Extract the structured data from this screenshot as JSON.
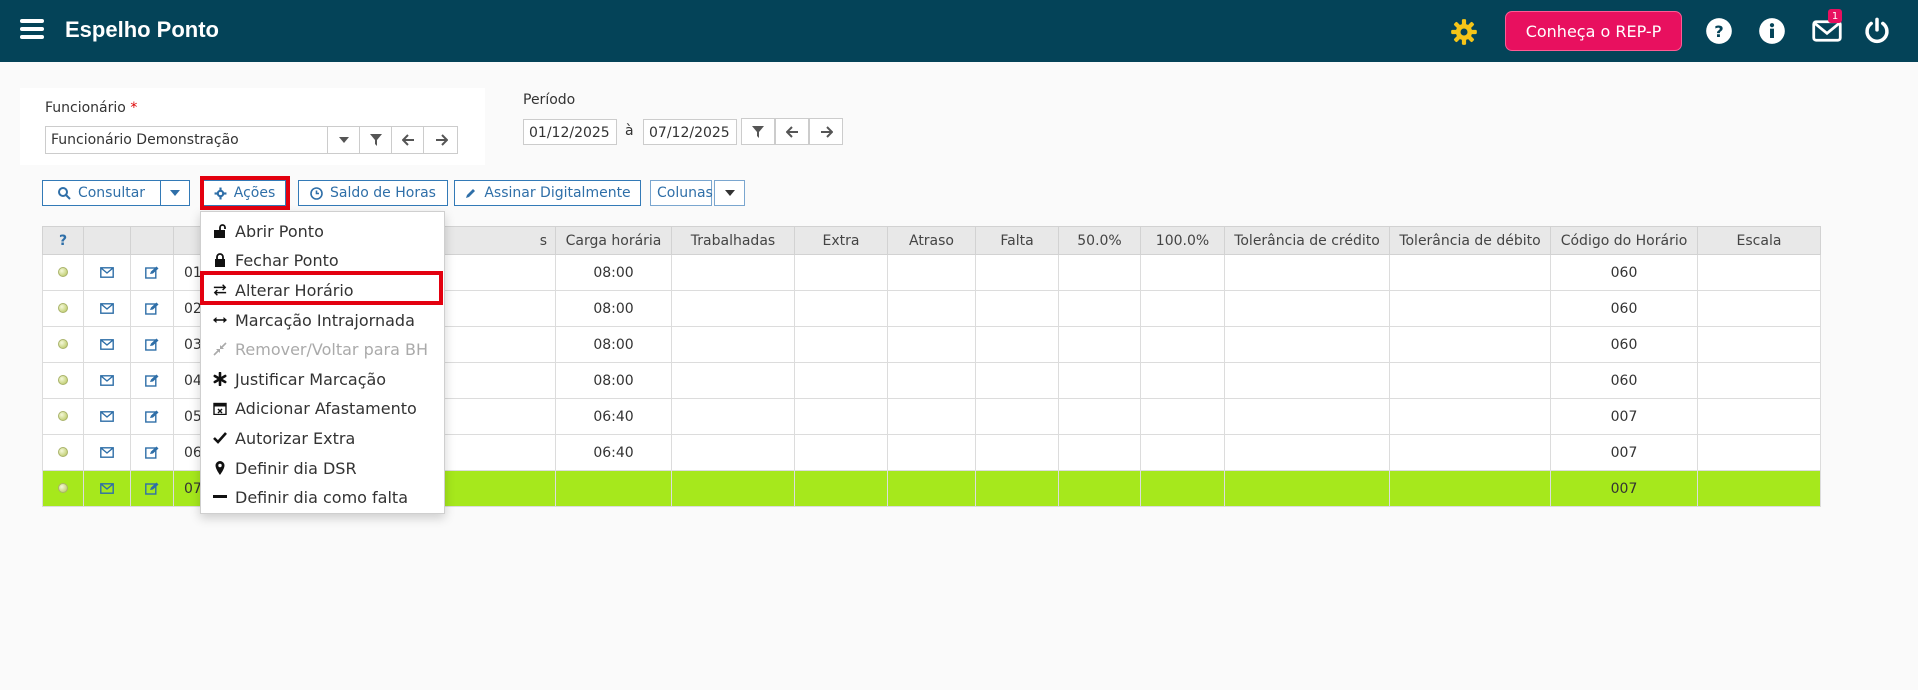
{
  "app": {
    "title": "Espelho Ponto"
  },
  "header": {
    "rep_button": "Conheça o REP-P",
    "notification_count": "1"
  },
  "filters": {
    "employee_label": "Funcionário",
    "required_mark": "*",
    "employee_value": "Funcionário Demonstração",
    "period_label": "Período",
    "date_from": "01/12/2025",
    "date_separator": "à",
    "date_to": "07/12/2025"
  },
  "toolbar": {
    "consultar": "Consultar",
    "acoes": "Ações",
    "saldo": "Saldo de Horas",
    "assinar": "Assinar Digitalmente",
    "colunas": "Colunas"
  },
  "table": {
    "columns": [
      "?",
      "",
      "",
      "",
      "s",
      "Carga horária",
      "Trabalhadas",
      "Extra",
      "Atraso",
      "Falta",
      "50.0%",
      "100.0%",
      "Tolerância de crédito",
      "Tolerância de débito",
      "Código do Horário",
      "Escala"
    ],
    "rows": [
      {
        "day": "01",
        "carga": "08:00",
        "codigo": "060"
      },
      {
        "day": "02",
        "carga": "08:00",
        "codigo": "060"
      },
      {
        "day": "03",
        "carga": "08:00",
        "codigo": "060"
      },
      {
        "day": "04",
        "carga": "08:00",
        "codigo": "060"
      },
      {
        "day": "05",
        "carga": "06:40",
        "codigo": "007"
      },
      {
        "day": "06",
        "carga": "06:40",
        "codigo": "007"
      },
      {
        "day": "07",
        "carga": "",
        "codigo": "007"
      }
    ]
  },
  "menu": {
    "items": [
      {
        "label": "Abrir Ponto",
        "icon": "unlock-icon",
        "disabled": false
      },
      {
        "label": "Fechar Ponto",
        "icon": "lock-icon",
        "disabled": false
      },
      {
        "label": "Alterar Horário",
        "icon": "swap-icon",
        "disabled": false
      },
      {
        "label": "Marcação Intrajornada",
        "icon": "arrows-horizontal-icon",
        "disabled": false
      },
      {
        "label": "Remover/Voltar para BH",
        "icon": "compress-icon",
        "disabled": true
      },
      {
        "label": "Justificar Marcação",
        "icon": "asterisk-icon",
        "disabled": false
      },
      {
        "label": "Adicionar Afastamento",
        "icon": "calendar-x-icon",
        "disabled": false
      },
      {
        "label": "Autorizar Extra",
        "icon": "check-icon",
        "disabled": false
      },
      {
        "label": "Definir dia DSR",
        "icon": "map-pin-icon",
        "disabled": false
      },
      {
        "label": "Definir dia como falta",
        "icon": "minus-icon",
        "disabled": false
      }
    ]
  },
  "colors": {
    "topbar": "#044358",
    "accent": "#e8105f",
    "selected_row": "#a6e81c",
    "highlight": "#e3000f",
    "gear": "#f5c518"
  }
}
